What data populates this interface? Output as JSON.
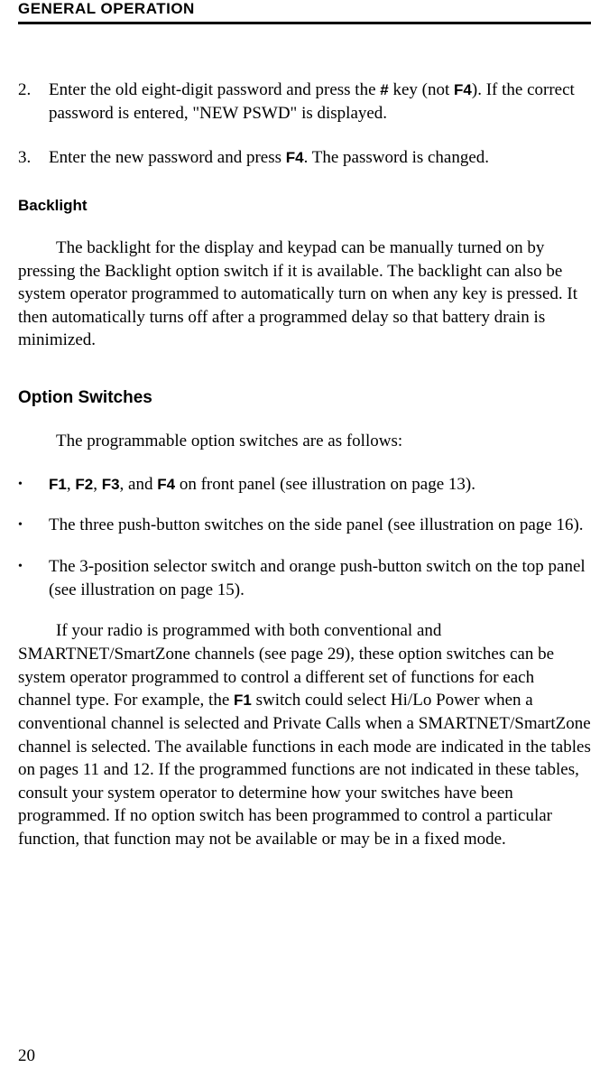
{
  "header": "GENERAL OPERATION",
  "step2_num": "2.",
  "step2_a": "Enter the old eight-digit password and press the ",
  "step2_hash": "#",
  "step2_b": " key (not ",
  "step2_f4": "F4",
  "step2_c": "). If the correct password is entered, \"NEW PSWD\" is displayed.",
  "step3_num": "3.",
  "step3_a": "Enter the new password and press ",
  "step3_f4": "F4",
  "step3_b": ". The password is changed.",
  "backlight_heading": "Backlight",
  "backlight_para": "The backlight for the display and keypad can be manually turned on by pressing the Backlight option switch if it is available. The backlight can also be system operator programmed to automatically turn on when any key is pressed. It then automatically turns off after a programmed delay so that battery drain is minimized.",
  "option_heading": "Option Switches",
  "option_intro": "The programmable option switches are as follows:",
  "b1_f1": "F1",
  "b1_sep1": ", ",
  "b1_f2": "F2",
  "b1_sep2": ", ",
  "b1_f3": "F3",
  "b1_sep3": ", and ",
  "b1_f4": "F4",
  "b1_rest": " on front panel (see illustration on page 13).",
  "b2": "The three push-button switches on the side panel (see illustration on page 16).",
  "b3": "The 3-position selector switch and orange push-button switch on the top panel (see illustration on page 15).",
  "final_a": "If your radio is programmed with both conventional and SMARTNET/SmartZone channels (see page 29), these option switches can be system operator programmed to control a different set of functions for each channel type. For example, the ",
  "final_f1": "F1",
  "final_b": " switch could select Hi/Lo Power when a conventional channel is selected and Private Calls when a SMARTNET/SmartZone channel is selected. The available functions in each mode are indicated in the tables on pages 11 and 12. If the programmed functions are not indicated in these tables, consult your system operator to determine how your switches have been programmed. If no option switch has been programmed to control a particular function, that function may not be available or may be in a fixed mode.",
  "page_number": "20",
  "bullet_char": "•"
}
